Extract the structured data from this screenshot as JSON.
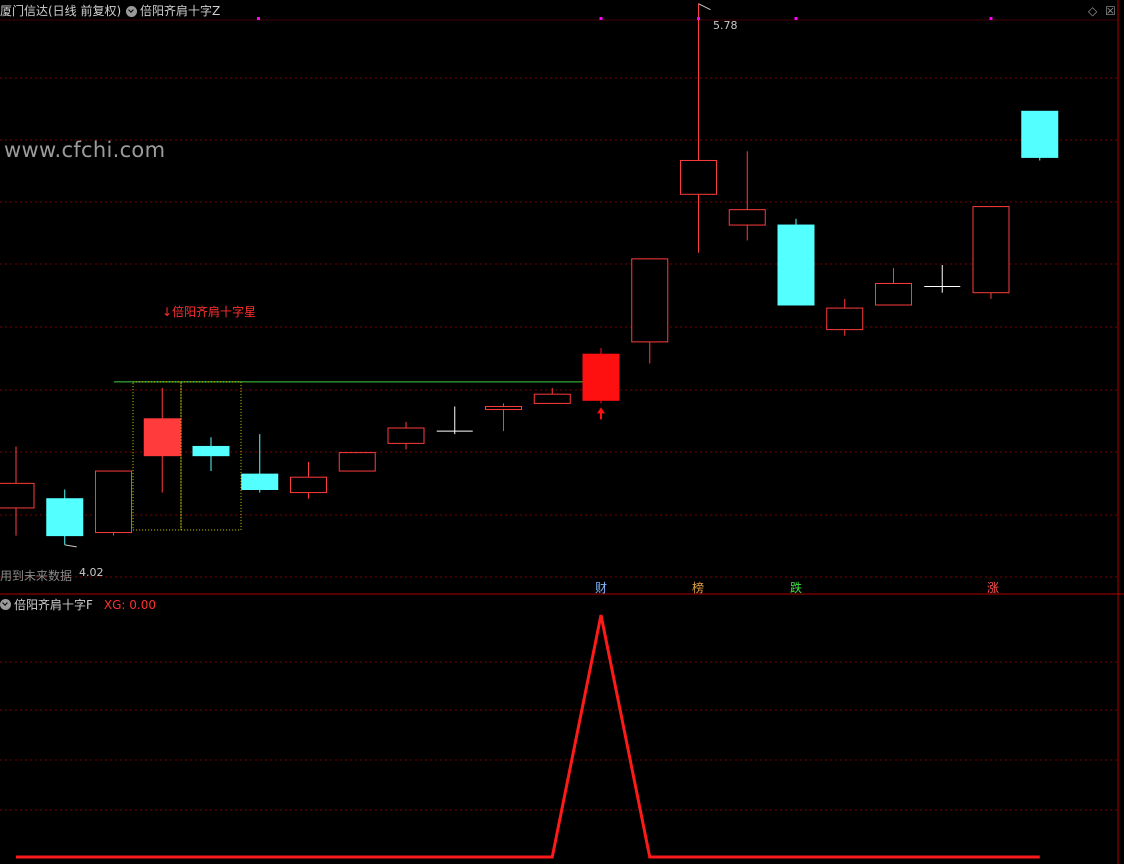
{
  "header": {
    "security_title": "厦门信达(日线 前复权)",
    "indicator_main": "倍阳齐肩十字Z",
    "diamond_icon": "diamond-icon",
    "close_icon": "close-icon"
  },
  "watermark": "www.cfchi.com",
  "signal_label": "↓倍阳齐肩十字星",
  "future_data_note": "用到未来数据",
  "low_price_label": "4.02",
  "high_price_label": "5.78",
  "events": [
    "财",
    "榜",
    "跌",
    "涨"
  ],
  "sub_panel": {
    "title": "倍阳齐肩十字F",
    "value_text": "XG: 0.00"
  },
  "colors": {
    "up": "#ff3b3b",
    "down": "#54ffff",
    "signal": "#ff1010",
    "reference_line": "#40d040",
    "grid": "#7a0000",
    "dots": "#ff00ff",
    "box": "#d8d800"
  },
  "chart_data": [
    {
      "type": "candlestick",
      "candles": [
        {
          "open": 4.14,
          "close": 4.22,
          "high": 4.34,
          "low": 4.05,
          "style": "hollow"
        },
        {
          "open": 4.17,
          "close": 4.05,
          "high": 4.2,
          "low": 4.02,
          "style": "solid"
        },
        {
          "open": 4.06,
          "close": 4.26,
          "high": 4.26,
          "low": 4.05,
          "style": "hollow"
        },
        {
          "open": 4.31,
          "close": 4.43,
          "high": 4.53,
          "low": 4.19,
          "style": "solid"
        },
        {
          "open": 4.34,
          "close": 4.31,
          "high": 4.37,
          "low": 4.26,
          "style": "solid"
        },
        {
          "open": 4.25,
          "close": 4.2,
          "high": 4.38,
          "low": 4.19,
          "style": "solid"
        },
        {
          "open": 4.19,
          "close": 4.24,
          "high": 4.29,
          "low": 4.17,
          "style": "hollow"
        },
        {
          "open": 4.26,
          "close": 4.32,
          "high": 4.32,
          "low": 4.26,
          "style": "hollow"
        },
        {
          "open": 4.35,
          "close": 4.4,
          "high": 4.42,
          "low": 4.33,
          "style": "hollow"
        },
        {
          "open": 4.39,
          "close": 4.39,
          "high": 4.47,
          "low": 4.38,
          "style": "cross"
        },
        {
          "open": 4.46,
          "close": 4.47,
          "high": 4.48,
          "low": 4.39,
          "style": "hollow"
        },
        {
          "open": 4.48,
          "close": 4.51,
          "high": 4.53,
          "low": 4.48,
          "style": "hollow"
        },
        {
          "open": 4.49,
          "close": 4.64,
          "high": 4.66,
          "low": 4.48,
          "style": "solid"
        },
        {
          "open": 4.68,
          "close": 4.95,
          "high": 4.95,
          "low": 4.61,
          "style": "hollow"
        },
        {
          "open": 5.16,
          "close": 5.27,
          "high": 5.78,
          "low": 4.97,
          "style": "hollow"
        },
        {
          "open": 5.06,
          "close": 5.11,
          "high": 5.3,
          "low": 5.01,
          "style": "hollow"
        },
        {
          "open": 5.06,
          "close": 4.8,
          "high": 5.08,
          "low": 4.8,
          "style": "solid"
        },
        {
          "open": 4.72,
          "close": 4.79,
          "high": 4.82,
          "low": 4.7,
          "style": "hollow"
        },
        {
          "open": 4.8,
          "close": 4.87,
          "high": 4.92,
          "low": 4.8,
          "style": "hollow"
        },
        {
          "open": 4.86,
          "close": 4.86,
          "high": 4.93,
          "low": 4.84,
          "style": "cross"
        },
        {
          "open": 4.84,
          "close": 5.12,
          "high": 5.12,
          "low": 4.82,
          "style": "hollow"
        },
        {
          "open": 5.43,
          "close": 5.28,
          "high": 5.43,
          "low": 5.27,
          "style": "solid"
        }
      ],
      "reference_price": 4.55,
      "signal_index": 12,
      "event_indices": [
        12,
        14,
        16,
        20
      ]
    },
    {
      "type": "line",
      "name": "XG",
      "values": [
        0,
        0,
        0,
        0,
        0,
        0,
        0,
        0,
        0,
        0,
        0,
        0,
        1,
        0,
        0,
        0,
        0,
        0,
        0,
        0,
        0,
        0
      ],
      "ylim": [
        0,
        1
      ]
    }
  ]
}
